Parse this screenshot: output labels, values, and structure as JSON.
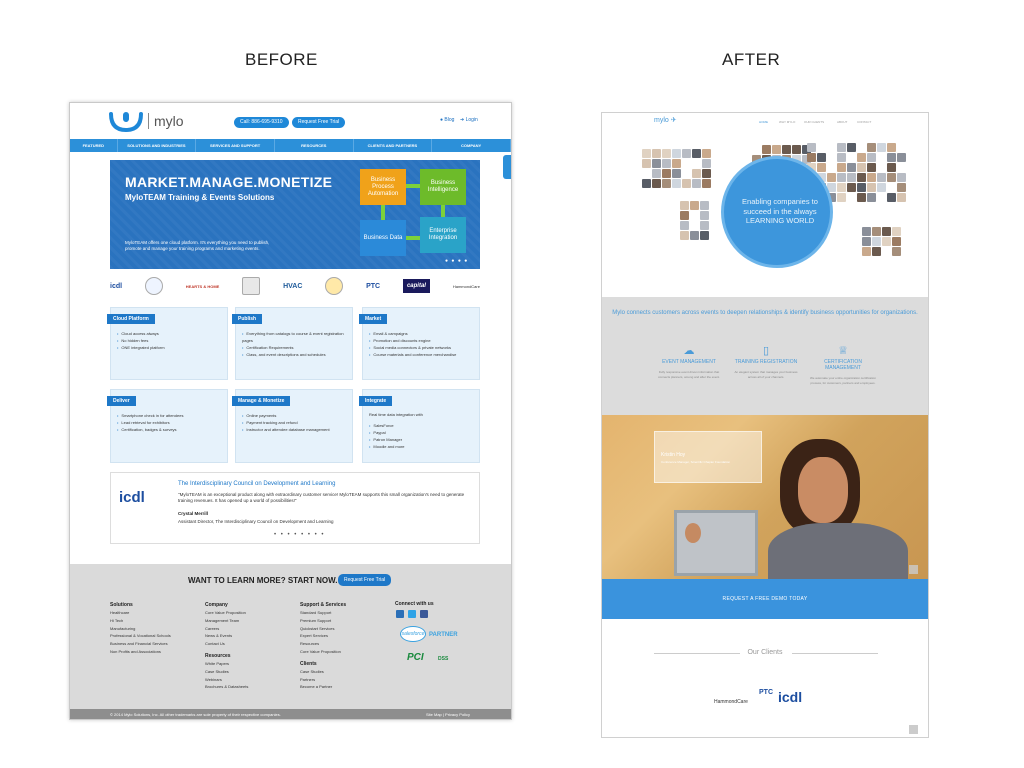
{
  "labels": {
    "before": "BEFORE",
    "after": "AFTER"
  },
  "before": {
    "logo_word": "mylo",
    "call_button": "Call: 886-695-9310",
    "trial_button": "Request Free Trial",
    "blog_link": "Blog",
    "login_link": "Login",
    "nav": [
      "FEATURED",
      "SOLUTIONS AND INDUSTRIES",
      "SERVICES AND SUPPORT",
      "RESOURCES",
      "CLIENTS AND PARTNERS",
      "COMPANY"
    ],
    "hero": {
      "title": "MARKET.MANAGE.MONETIZE",
      "subtitle": "MyloTEAM Training & Events Solutions",
      "body": "MyloTEAM offers one cloud platform. It's everything you need to publish, promote and manage your training programs and marketing events.",
      "boxes": [
        "Business Process Automation",
        "Business Intelligence",
        "Business Data",
        "Enterprise Integration"
      ]
    },
    "logos": [
      "icdl",
      "HEARTS & HOME",
      "HVAC",
      "PTC",
      "capital",
      "HammondCare"
    ],
    "cards": [
      {
        "title": "Cloud Platform",
        "items": [
          "Cloud access always",
          "No hidden fees",
          "ONE integrated platform"
        ]
      },
      {
        "title": "Publish",
        "items": [
          "Everything from catalogs to course & event registration pages",
          "Certification Requirements",
          "Class, and event descriptions and schedules"
        ]
      },
      {
        "title": "Market",
        "items": [
          "Email & campaigns",
          "Promotion and discounts engine",
          "Social media connectors & private networks",
          "Course materials and conference merchandise"
        ]
      },
      {
        "title": "Deliver",
        "items": [
          "Smartphone check in for attendees",
          "Lead retrieval for exhibitors",
          "Certification, badges & surveys"
        ]
      },
      {
        "title": "Manage & Monetize",
        "items": [
          "Online payments",
          "Payment tracking and refund",
          "Instructor and attendee database management"
        ]
      },
      {
        "title": "Integrate",
        "intro": "Real time data integration with",
        "items": [
          "SalesForce",
          "Paypal",
          "Patron Manager",
          "Moodle and more"
        ]
      }
    ],
    "testimonial": {
      "logo": "icdl",
      "title": "The Interdisciplinary Council on Development and Learning",
      "text": "\"MyloTEAM is an exceptional product along with extraordinary customer service! MyloTEAM supports this small organization's need to generate training revenues. It has opened up a world of possibilities!\"",
      "name": "Crystal Merrill",
      "role": "Assistant Director, The Interdisciplinary Council on Development and Learning",
      "dots": "• • • • • • • •"
    },
    "footer": {
      "cta": "WANT TO LEARN MORE? START NOW.",
      "cta_button": "Request Free Trial",
      "solutions": {
        "heading": "Solutions",
        "items": [
          "Healthcare",
          "Hi Tech",
          "Manufacturing",
          "Professional & Vocational Schools",
          "Business and Financial Services",
          "Non Profits and Associations"
        ]
      },
      "company": {
        "heading": "Company",
        "items": [
          "Core Value Proposition",
          "Management Team",
          "Careers",
          "News & Events",
          "Contact Us"
        ]
      },
      "resources": {
        "heading": "Resources",
        "items": [
          "White Papers",
          "Case Studies",
          "Webinars",
          "Brochures & Datasheets"
        ]
      },
      "support": {
        "heading": "Support & Services",
        "items": [
          "Standard Support",
          "Premium Support",
          "Quickstart Services",
          "Expert Services",
          "Resources",
          "Core Value Proposition"
        ]
      },
      "clients": {
        "heading": "Clients",
        "items": [
          "Case Studies",
          "Partners",
          "Become a Partner"
        ]
      },
      "connect": "Connect with us",
      "salesforce": "salesforce",
      "partner": "PARTNER",
      "pci": "PCI",
      "dss": "DSS",
      "copyright": "© 2014 Mylo Solutions, Inc. All other trademarks are sole property of their respective companies.",
      "links": "Site Map | Privacy Policy"
    }
  },
  "after": {
    "logo": "mylo",
    "nav": [
      "HOME",
      "WHY MYLO",
      "OUR CLIENTS",
      "ABOUT",
      "CONTACT"
    ],
    "hero_text": "Enabling companies to succeed in the always LEARNING WORLD",
    "lead": "Mylo connects customers across events to deepen relationships & identify business opportunities for organizations.",
    "features": [
      {
        "icon": "cloud-icon",
        "title": "EVENT MANAGEMENT",
        "text": "Fully responsive event driven information that connects planners, among and after the event."
      },
      {
        "icon": "tablet-icon",
        "title": "TRAINING REGISTRATION",
        "text": "An elegant system that manages your business across all of your channels."
      },
      {
        "icon": "trophy-icon",
        "title": "CERTIFICATION MANAGEMENT",
        "text": "We automate your entire organization certification process, for customers, partners and employees."
      }
    ],
    "testimonial_name": "Kristin Hoy",
    "testimonial_role": "Conference Manager, Scientific Chapter Foundation",
    "demo_button": "REQUEST A FREE DEMO TODAY",
    "clients_title": "Our Clients",
    "clients": [
      "HammondCare",
      "PTC",
      "icdl"
    ]
  },
  "colors": {
    "brand_blue": "#2c90d9",
    "after_blue": "#3a93dd"
  }
}
